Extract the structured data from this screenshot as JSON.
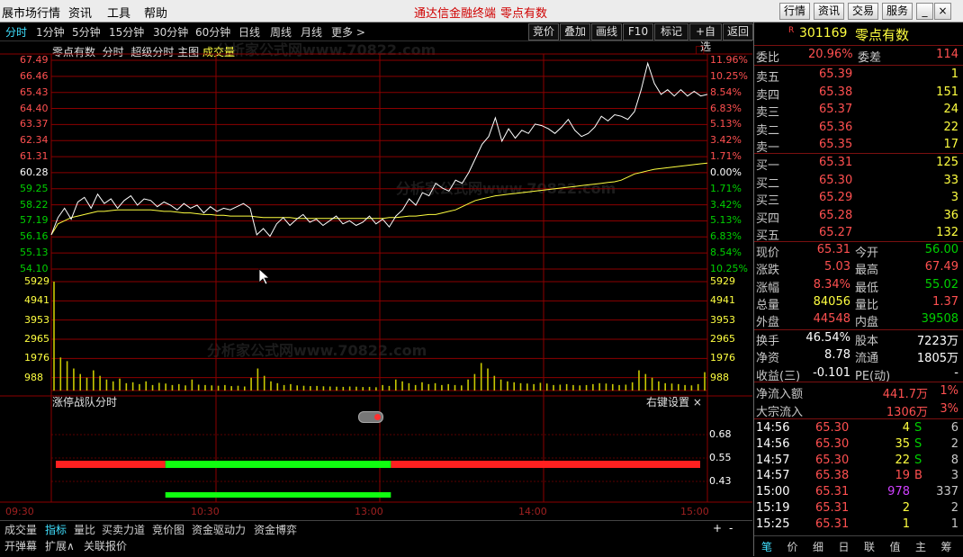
{
  "menu": {
    "items": [
      "展市场行情",
      "资讯",
      "工具",
      "帮助"
    ],
    "center": "通达信金融终端",
    "stock_name": "零点有数",
    "right_buttons": [
      "行情",
      "资讯",
      "交易",
      "服务"
    ]
  },
  "periods": [
    "分时",
    "1分钟",
    "5分钟",
    "15分钟",
    "30分钟",
    "60分钟",
    "日线",
    "周线",
    "月线",
    "更多 >"
  ],
  "tools": [
    "竞价",
    "叠加",
    "画线",
    "F10",
    "标记",
    "+自选",
    "返回"
  ],
  "chart_header": {
    "name": "零点有数",
    "mode": "分时",
    "super": "超级分时",
    "main": "主图",
    "vol": "成交量",
    "restore_icon": "□"
  },
  "price_axis": {
    "left": [
      "67.49",
      "66.46",
      "65.43",
      "64.40",
      "63.37",
      "62.34",
      "61.31",
      "60.28",
      "59.25",
      "58.22",
      "57.19",
      "56.16",
      "55.13",
      "54.10"
    ],
    "right": [
      "11.96%",
      "10.25%",
      "8.54%",
      "6.83%",
      "5.13%",
      "3.42%",
      "1.71%",
      "0.00%",
      "1.71%",
      "3.42%",
      "5.13%",
      "6.83%",
      "8.54%",
      "10.25%"
    ]
  },
  "vol_axis": [
    "5929",
    "4941",
    "3953",
    "2965",
    "1976",
    "988"
  ],
  "indicator": {
    "title": "涨停战队分时",
    "settings": "右键设置 ×",
    "axis": [
      "0.68",
      "0.55",
      "0.43"
    ]
  },
  "time_axis": [
    "09:30",
    "10:30",
    "13:00",
    "14:00",
    "15:00"
  ],
  "bottom_tabs": [
    "成交量",
    "指标",
    "量比",
    "买卖力道",
    "竞价图",
    "资金驱动力",
    "资金博弈"
  ],
  "bottom_tabs2": [
    "开弹幕",
    "扩展∧",
    "关联报价"
  ],
  "bottom_plus": "+",
  "bottom_minus": "-",
  "quote": {
    "code": "301169",
    "name": "零点有数",
    "r_mark": "R",
    "weibi": {
      "label": "委比",
      "value": "20.96%",
      "label2": "委差",
      "value2": "114"
    },
    "asks": [
      {
        "label": "卖五",
        "price": "65.39",
        "vol": "1"
      },
      {
        "label": "卖四",
        "price": "65.38",
        "vol": "151"
      },
      {
        "label": "卖三",
        "price": "65.37",
        "vol": "24"
      },
      {
        "label": "卖二",
        "price": "65.36",
        "vol": "22"
      },
      {
        "label": "卖一",
        "price": "65.35",
        "vol": "17"
      }
    ],
    "bids": [
      {
        "label": "买一",
        "price": "65.31",
        "vol": "125"
      },
      {
        "label": "买二",
        "price": "65.30",
        "vol": "33"
      },
      {
        "label": "买三",
        "price": "65.29",
        "vol": "3"
      },
      {
        "label": "买四",
        "price": "65.28",
        "vol": "36"
      },
      {
        "label": "买五",
        "price": "65.27",
        "vol": "132"
      }
    ],
    "stats": [
      {
        "l1": "现价",
        "v1": "65.31",
        "l2": "今开",
        "v2": "56.00"
      },
      {
        "l1": "涨跌",
        "v1": "5.03",
        "l2": "最高",
        "v2": "67.49"
      },
      {
        "l1": "涨幅",
        "v1": "8.34%",
        "l2": "最低",
        "v2": "55.02"
      },
      {
        "l1": "总量",
        "v1": "84056",
        "l2": "量比",
        "v2": "1.37"
      },
      {
        "l1": "外盘",
        "v1": "44548",
        "l2": "内盘",
        "v2": "39508"
      }
    ],
    "stats2": [
      {
        "l1": "换手",
        "v1": "46.54%",
        "l2": "股本",
        "v2": "7223万"
      },
      {
        "l1": "净资",
        "v1": "8.78",
        "l2": "流通",
        "v2": "1805万"
      },
      {
        "l1": "收益(三)",
        "v1": "-0.101",
        "l2": "PE(动)",
        "v2": "-"
      }
    ],
    "flow": [
      {
        "label": "净流入额",
        "value": "441.7万",
        "pct": "1%"
      },
      {
        "label": "大宗流入",
        "value": "1306万",
        "pct": "3%"
      }
    ],
    "ticks": [
      {
        "time": "14:56",
        "price": "65.30",
        "vol": "4",
        "bs": "S",
        "n": "6"
      },
      {
        "time": "14:56",
        "price": "65.30",
        "vol": "35",
        "bs": "S",
        "n": "2"
      },
      {
        "time": "14:57",
        "price": "65.30",
        "vol": "22",
        "bs": "S",
        "n": "8"
      },
      {
        "time": "14:57",
        "price": "65.38",
        "vol": "19",
        "bs": "B",
        "n": "3"
      },
      {
        "time": "15:00",
        "price": "65.31",
        "vol": "978",
        "bs": "",
        "n": "337"
      },
      {
        "time": "15:19",
        "price": "65.31",
        "vol": "2",
        "bs": "",
        "n": "2"
      },
      {
        "time": "15:25",
        "price": "65.31",
        "vol": "1",
        "bs": "",
        "n": "1"
      }
    ],
    "bottom_tabs": [
      "笔",
      "价",
      "细",
      "日",
      "联",
      "值",
      "主",
      "筹"
    ]
  },
  "watermark": "分析家公式网www.70822.com",
  "colors": {
    "up": "#ff5050",
    "down": "#00d000",
    "grid": "#8b0000",
    "price_line": "#ffffff",
    "avg_line": "#ffff40"
  },
  "chart_data": {
    "type": "line",
    "x_axis": [
      "09:30",
      "10:30",
      "13:00",
      "14:00",
      "15:00"
    ],
    "ylim": [
      54.1,
      67.49
    ],
    "prev_close": 60.28,
    "series": [
      {
        "values": [
          56.3,
          57.4,
          58.0,
          57.3,
          58.4,
          58.7,
          58.0,
          58.9,
          58.3,
          58.6,
          58.0,
          58.5,
          58.8,
          58.2,
          58.6,
          58.5,
          58.1,
          58.4,
          58.2,
          57.9,
          58.3,
          58.0,
          58.2,
          57.7,
          58.1,
          57.8,
          58.0,
          57.9,
          58.1,
          58.3,
          58.0,
          56.3,
          56.7,
          56.2,
          57.0,
          57.4,
          56.9,
          57.3,
          57.6,
          57.1,
          57.3,
          56.9,
          57.2,
          57.5,
          57.0,
          57.2,
          56.9,
          57.1,
          57.5,
          57.0,
          57.3,
          56.8,
          57.5,
          57.9,
          58.6,
          58.2,
          59.0,
          58.8,
          59.6,
          59.3,
          59.1,
          59.8,
          59.6,
          60.3,
          61.2,
          62.1,
          62.6,
          63.8,
          62.3,
          63.1,
          62.5,
          63.0,
          62.8,
          63.4,
          63.3,
          63.1,
          62.8,
          63.2,
          63.7,
          63.0,
          62.6,
          62.8,
          63.2,
          63.9,
          63.6,
          64.0,
          63.9,
          63.7,
          64.2,
          65.6,
          67.3,
          66.0,
          65.3,
          65.6,
          65.2,
          65.6,
          65.2,
          65.5,
          65.2,
          65.3
        ]
      },
      {
        "values": [
          56.3,
          57.0,
          57.2,
          57.4,
          57.5,
          57.6,
          57.7,
          57.8,
          57.8,
          57.85,
          57.9,
          57.9,
          57.9,
          57.9,
          57.9,
          57.9,
          57.85,
          57.8,
          57.8,
          57.75,
          57.7,
          57.7,
          57.65,
          57.6,
          57.6,
          57.55,
          57.55,
          57.5,
          57.5,
          57.5,
          57.5,
          57.45,
          57.4,
          57.4,
          57.4,
          57.4,
          57.4,
          57.35,
          57.35,
          57.35,
          57.35,
          57.35,
          57.35,
          57.35,
          57.35,
          57.35,
          57.35,
          57.35,
          57.35,
          57.35,
          57.35,
          57.4,
          57.4,
          57.45,
          57.5,
          57.5,
          57.55,
          57.6,
          57.6,
          57.7,
          57.8,
          57.9,
          58.1,
          58.3,
          58.5,
          58.6,
          58.7,
          58.8,
          58.85,
          58.9,
          58.95,
          59.0,
          59.05,
          59.1,
          59.15,
          59.2,
          59.25,
          59.3,
          59.35,
          59.4,
          59.45,
          59.5,
          59.55,
          59.6,
          59.65,
          59.7,
          59.8,
          60.0,
          60.2,
          60.3,
          60.4,
          60.5,
          60.55,
          60.6,
          60.65,
          60.7,
          60.75,
          60.8,
          60.85,
          60.9
        ]
      }
    ],
    "volume": [
      5929,
      1800,
      1600,
      1200,
      900,
      700,
      1100,
      800,
      600,
      500,
      650,
      400,
      450,
      350,
      500,
      300,
      420,
      380,
      300,
      350,
      280,
      600,
      320,
      300,
      280,
      260,
      300,
      240,
      260,
      220,
      700,
      1200,
      800,
      500,
      400,
      300,
      350,
      280,
      260,
      240,
      250,
      230,
      220,
      210,
      200,
      220,
      210,
      190,
      200,
      180,
      300,
      250,
      600,
      500,
      400,
      300,
      450,
      350,
      400,
      300,
      350,
      300,
      280,
      600,
      900,
      1500,
      1200,
      800,
      600,
      500,
      450,
      400,
      380,
      350,
      420,
      380,
      300,
      320,
      350,
      300,
      280,
      300,
      350,
      400,
      380,
      350,
      300,
      320,
      450,
      1100,
      900,
      700,
      500,
      400,
      380,
      350,
      300,
      280,
      350,
      1000
    ],
    "indicator": {
      "red_zones": [
        [
          0,
          0.17
        ],
        [
          0.52,
          1.0
        ]
      ],
      "green_zones": [
        [
          0.17,
          0.52
        ]
      ],
      "level": 0.55
    }
  }
}
